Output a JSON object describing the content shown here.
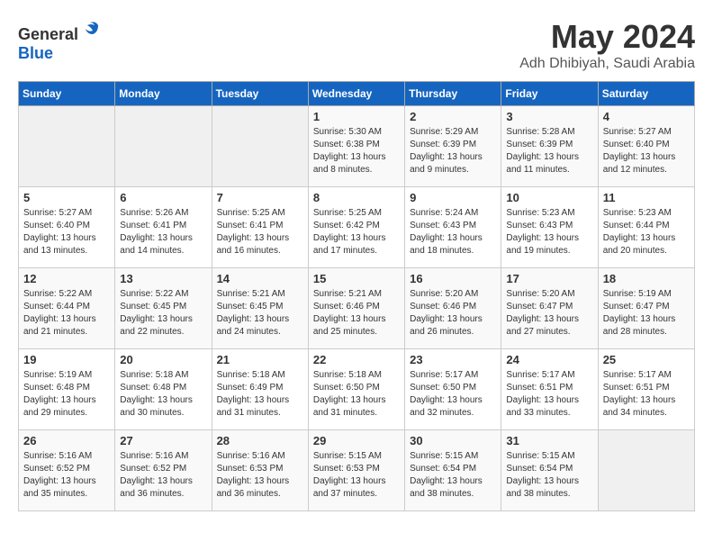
{
  "logo": {
    "general": "General",
    "blue": "Blue"
  },
  "header": {
    "month": "May 2024",
    "location": "Adh Dhibiyah, Saudi Arabia"
  },
  "weekdays": [
    "Sunday",
    "Monday",
    "Tuesday",
    "Wednesday",
    "Thursday",
    "Friday",
    "Saturday"
  ],
  "weeks": [
    [
      {
        "day": "",
        "info": ""
      },
      {
        "day": "",
        "info": ""
      },
      {
        "day": "",
        "info": ""
      },
      {
        "day": "1",
        "info": "Sunrise: 5:30 AM\nSunset: 6:38 PM\nDaylight: 13 hours\nand 8 minutes."
      },
      {
        "day": "2",
        "info": "Sunrise: 5:29 AM\nSunset: 6:39 PM\nDaylight: 13 hours\nand 9 minutes."
      },
      {
        "day": "3",
        "info": "Sunrise: 5:28 AM\nSunset: 6:39 PM\nDaylight: 13 hours\nand 11 minutes."
      },
      {
        "day": "4",
        "info": "Sunrise: 5:27 AM\nSunset: 6:40 PM\nDaylight: 13 hours\nand 12 minutes."
      }
    ],
    [
      {
        "day": "5",
        "info": "Sunrise: 5:27 AM\nSunset: 6:40 PM\nDaylight: 13 hours\nand 13 minutes."
      },
      {
        "day": "6",
        "info": "Sunrise: 5:26 AM\nSunset: 6:41 PM\nDaylight: 13 hours\nand 14 minutes."
      },
      {
        "day": "7",
        "info": "Sunrise: 5:25 AM\nSunset: 6:41 PM\nDaylight: 13 hours\nand 16 minutes."
      },
      {
        "day": "8",
        "info": "Sunrise: 5:25 AM\nSunset: 6:42 PM\nDaylight: 13 hours\nand 17 minutes."
      },
      {
        "day": "9",
        "info": "Sunrise: 5:24 AM\nSunset: 6:43 PM\nDaylight: 13 hours\nand 18 minutes."
      },
      {
        "day": "10",
        "info": "Sunrise: 5:23 AM\nSunset: 6:43 PM\nDaylight: 13 hours\nand 19 minutes."
      },
      {
        "day": "11",
        "info": "Sunrise: 5:23 AM\nSunset: 6:44 PM\nDaylight: 13 hours\nand 20 minutes."
      }
    ],
    [
      {
        "day": "12",
        "info": "Sunrise: 5:22 AM\nSunset: 6:44 PM\nDaylight: 13 hours\nand 21 minutes."
      },
      {
        "day": "13",
        "info": "Sunrise: 5:22 AM\nSunset: 6:45 PM\nDaylight: 13 hours\nand 22 minutes."
      },
      {
        "day": "14",
        "info": "Sunrise: 5:21 AM\nSunset: 6:45 PM\nDaylight: 13 hours\nand 24 minutes."
      },
      {
        "day": "15",
        "info": "Sunrise: 5:21 AM\nSunset: 6:46 PM\nDaylight: 13 hours\nand 25 minutes."
      },
      {
        "day": "16",
        "info": "Sunrise: 5:20 AM\nSunset: 6:46 PM\nDaylight: 13 hours\nand 26 minutes."
      },
      {
        "day": "17",
        "info": "Sunrise: 5:20 AM\nSunset: 6:47 PM\nDaylight: 13 hours\nand 27 minutes."
      },
      {
        "day": "18",
        "info": "Sunrise: 5:19 AM\nSunset: 6:47 PM\nDaylight: 13 hours\nand 28 minutes."
      }
    ],
    [
      {
        "day": "19",
        "info": "Sunrise: 5:19 AM\nSunset: 6:48 PM\nDaylight: 13 hours\nand 29 minutes."
      },
      {
        "day": "20",
        "info": "Sunrise: 5:18 AM\nSunset: 6:48 PM\nDaylight: 13 hours\nand 30 minutes."
      },
      {
        "day": "21",
        "info": "Sunrise: 5:18 AM\nSunset: 6:49 PM\nDaylight: 13 hours\nand 31 minutes."
      },
      {
        "day": "22",
        "info": "Sunrise: 5:18 AM\nSunset: 6:50 PM\nDaylight: 13 hours\nand 31 minutes."
      },
      {
        "day": "23",
        "info": "Sunrise: 5:17 AM\nSunset: 6:50 PM\nDaylight: 13 hours\nand 32 minutes."
      },
      {
        "day": "24",
        "info": "Sunrise: 5:17 AM\nSunset: 6:51 PM\nDaylight: 13 hours\nand 33 minutes."
      },
      {
        "day": "25",
        "info": "Sunrise: 5:17 AM\nSunset: 6:51 PM\nDaylight: 13 hours\nand 34 minutes."
      }
    ],
    [
      {
        "day": "26",
        "info": "Sunrise: 5:16 AM\nSunset: 6:52 PM\nDaylight: 13 hours\nand 35 minutes."
      },
      {
        "day": "27",
        "info": "Sunrise: 5:16 AM\nSunset: 6:52 PM\nDaylight: 13 hours\nand 36 minutes."
      },
      {
        "day": "28",
        "info": "Sunrise: 5:16 AM\nSunset: 6:53 PM\nDaylight: 13 hours\nand 36 minutes."
      },
      {
        "day": "29",
        "info": "Sunrise: 5:15 AM\nSunset: 6:53 PM\nDaylight: 13 hours\nand 37 minutes."
      },
      {
        "day": "30",
        "info": "Sunrise: 5:15 AM\nSunset: 6:54 PM\nDaylight: 13 hours\nand 38 minutes."
      },
      {
        "day": "31",
        "info": "Sunrise: 5:15 AM\nSunset: 6:54 PM\nDaylight: 13 hours\nand 38 minutes."
      },
      {
        "day": "",
        "info": ""
      }
    ]
  ]
}
